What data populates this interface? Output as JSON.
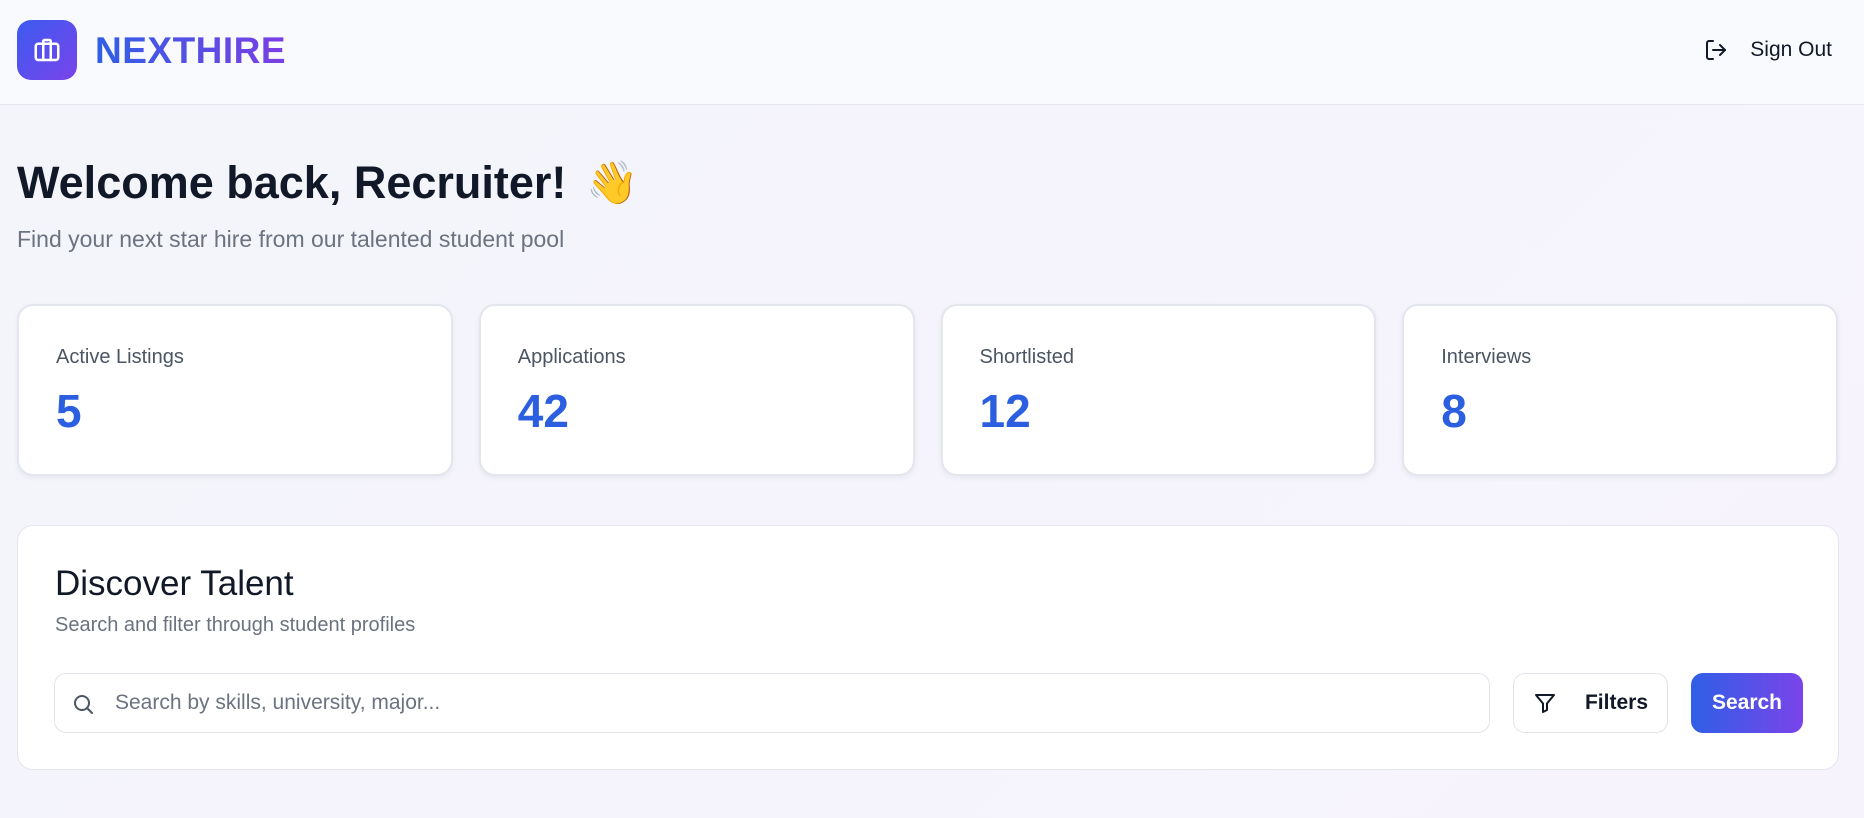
{
  "header": {
    "brand": "NEXTHIRE",
    "logo_icon": "briefcase-icon",
    "sign_out_label": "Sign Out",
    "sign_out_icon": "log-out-icon"
  },
  "welcome": {
    "title": "Welcome back, Recruiter!",
    "emoji": "👋",
    "subtitle": "Find your next star hire from our talented student pool"
  },
  "stats": [
    {
      "label": "Active Listings",
      "value": "5"
    },
    {
      "label": "Applications",
      "value": "42"
    },
    {
      "label": "Shortlisted",
      "value": "12"
    },
    {
      "label": "Interviews",
      "value": "8"
    }
  ],
  "discover": {
    "title": "Discover Talent",
    "subtitle": "Search and filter through student profiles",
    "search_placeholder": "Search by skills, university, major...",
    "search_value": "",
    "search_icon": "search-icon",
    "filters_label": "Filters",
    "filters_icon": "filter-icon",
    "search_button_label": "Search"
  },
  "colors": {
    "accent_blue": "#2b5fe0",
    "accent_purple": "#7a44ea"
  }
}
